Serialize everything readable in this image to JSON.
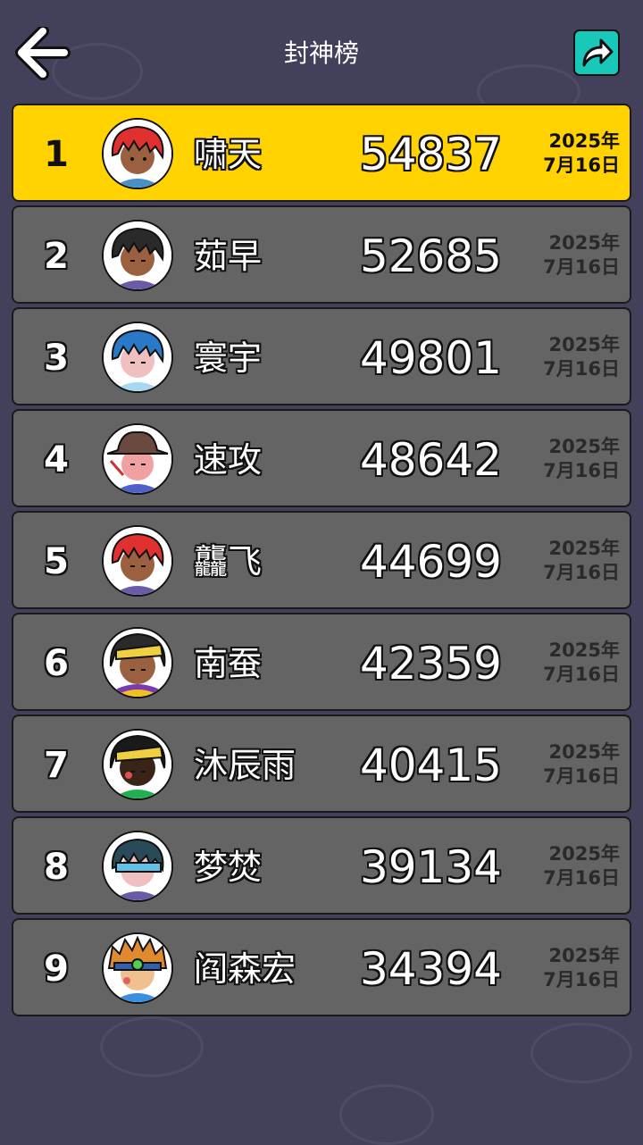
{
  "header": {
    "title": "封神榜",
    "back_icon": "arrow-left-icon",
    "share_icon": "share-arrow-icon"
  },
  "colors": {
    "background": "#42405a",
    "row": "#646464",
    "top_row": "#ffd200",
    "share_button": "#18c8b8"
  },
  "leaderboard": [
    {
      "rank": "1",
      "name": "啸天",
      "score": "54837",
      "date_year": "2025年",
      "date_day": "7月16日",
      "avatar": "avatar-red-hair"
    },
    {
      "rank": "2",
      "name": "茹早",
      "score": "52685",
      "date_year": "2025年",
      "date_day": "7月16日",
      "avatar": "avatar-black-hair"
    },
    {
      "rank": "3",
      "name": "寰宇",
      "score": "49801",
      "date_year": "2025年",
      "date_day": "7月16日",
      "avatar": "avatar-blue-hair"
    },
    {
      "rank": "4",
      "name": "速攻",
      "score": "48642",
      "date_year": "2025年",
      "date_day": "7月16日",
      "avatar": "avatar-brown-hat"
    },
    {
      "rank": "5",
      "name": "龘飞",
      "score": "44699",
      "date_year": "2025年",
      "date_day": "7月16日",
      "avatar": "avatar-red-hair"
    },
    {
      "rank": "6",
      "name": "南蚕",
      "score": "42359",
      "date_year": "2025年",
      "date_day": "7月16日",
      "avatar": "avatar-yellow-headband"
    },
    {
      "rank": "7",
      "name": "沐辰雨",
      "score": "40415",
      "date_year": "2025年",
      "date_day": "7月16日",
      "avatar": "avatar-yellow-headband-green"
    },
    {
      "rank": "8",
      "name": "梦焚",
      "score": "39134",
      "date_year": "2025年",
      "date_day": "7月16日",
      "avatar": "avatar-blue-headband"
    },
    {
      "rank": "9",
      "name": "阎森宏",
      "score": "34394",
      "date_year": "2025年",
      "date_day": "7月16日",
      "avatar": "avatar-orange-hair"
    }
  ]
}
